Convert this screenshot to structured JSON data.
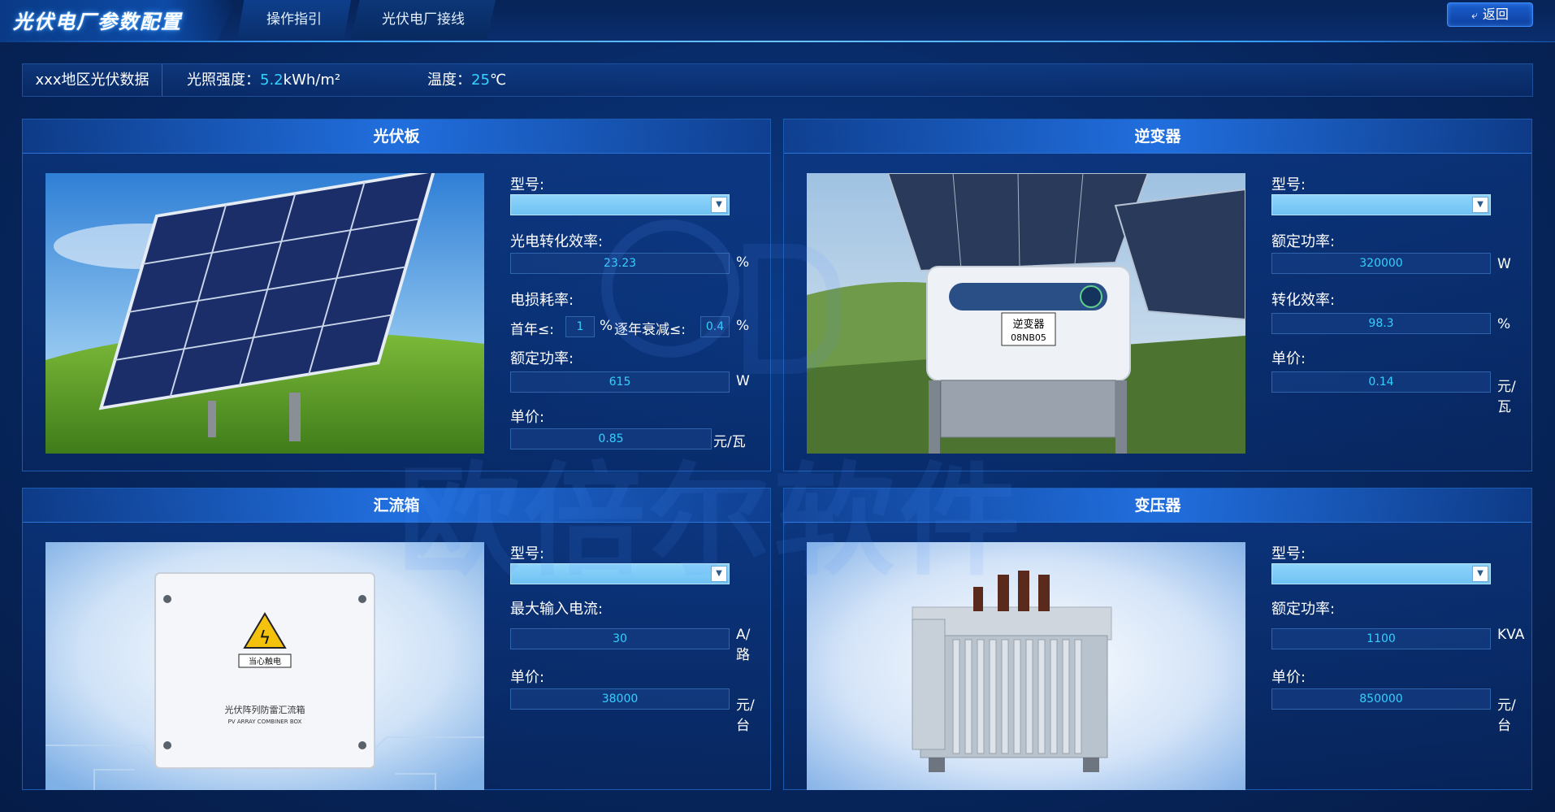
{
  "header": {
    "title": "光伏电厂参数配置",
    "tabs": [
      "操作指引",
      "光伏电厂接线"
    ],
    "back_label": "返回"
  },
  "info": {
    "region": "xxx地区光伏数据",
    "light_label": "光照强度：",
    "light_value": "5.2",
    "light_unit": "kWh/m²",
    "temp_label": "温度：",
    "temp_value": "25",
    "temp_unit": "℃"
  },
  "panels": {
    "pv": {
      "title": "光伏板",
      "model_label": "型号:",
      "efficiency_label": "光电转化效率:",
      "efficiency_value": "23.23",
      "efficiency_unit": "%",
      "loss_label": "电损耗率:",
      "first_year_label": "首年≤:",
      "first_year_value": "1",
      "first_year_unit": "%",
      "decay_label": "逐年衰减≤:",
      "decay_value": "0.4",
      "decay_unit": "%",
      "power_label": "额定功率:",
      "power_value": "615",
      "power_unit": "W",
      "price_label": "单价:",
      "price_value": "0.85",
      "price_unit": "元/瓦"
    },
    "inverter": {
      "title": "逆变器",
      "model_label": "型号:",
      "power_label": "额定功率:",
      "power_value": "320000",
      "power_unit": "W",
      "efficiency_label": "转化效率:",
      "efficiency_value": "98.3",
      "efficiency_unit": "%",
      "price_label": "单价:",
      "price_value": "0.14",
      "price_unit": "元/瓦",
      "device_label": "逆变器",
      "device_code": "08NB05"
    },
    "combiner": {
      "title": "汇流箱",
      "model_label": "型号:",
      "current_label": "最大输入电流:",
      "current_value": "30",
      "current_unit": "A/路",
      "price_label": "单价:",
      "price_value": "38000",
      "price_unit": "元/台",
      "box_warning": "当心触电",
      "box_caption_cn": "光伏阵列防雷汇流箱",
      "box_caption_en": "PV ARRAY COMBINER BOX"
    },
    "transformer": {
      "title": "变压器",
      "model_label": "型号:",
      "power_label": "额定功率:",
      "power_value": "1100",
      "power_unit": "KVA",
      "price_label": "单价:",
      "price_value": "850000",
      "price_unit": "元/台"
    }
  },
  "watermark": "欧倍尔软件",
  "colors": {
    "background": "#082a66",
    "accent": "#38d2ff",
    "select": "#7fcbf6",
    "border": "#1d5bb0"
  }
}
